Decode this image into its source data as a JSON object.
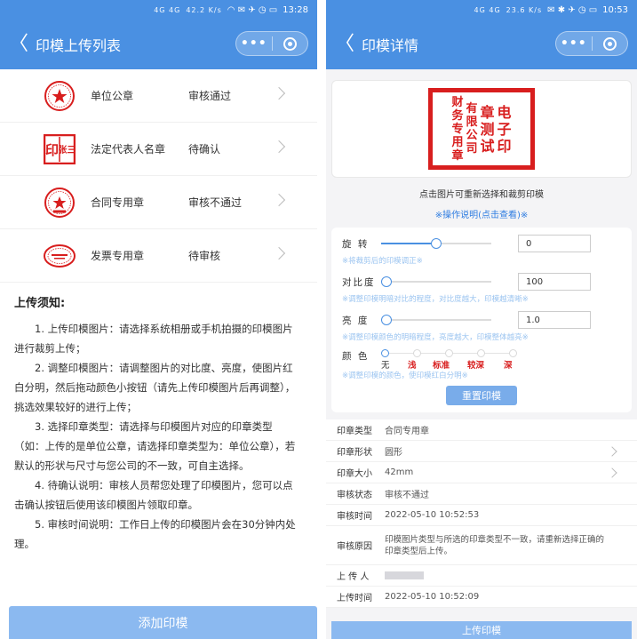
{
  "left": {
    "status": {
      "network": "4G 4G",
      "speed": "42.2 K/s",
      "time": "13:28"
    },
    "nav": {
      "back": "〈",
      "title": "印模上传列表",
      "more": "•••"
    },
    "seals": [
      {
        "name": "单位公章",
        "status": "审核通过",
        "icon": "round-official-seal-icon"
      },
      {
        "name": "法定代表人名章",
        "status": "待确认",
        "icon": "square-personal-seal-icon",
        "seal_text": [
          "印",
          "张三"
        ]
      },
      {
        "name": "合同专用章",
        "status": "审核不通过",
        "icon": "round-contract-seal-icon"
      },
      {
        "name": "发票专用章",
        "status": "待审核",
        "icon": "oval-invoice-seal-icon"
      }
    ],
    "notice": {
      "title": "上传须知:",
      "items": [
        "1. 上传印模图片：请选择系统相册或手机拍摄的印模图片进行裁剪上传；",
        "2. 调整印模图片：请调整图片的对比度、亮度，使图片红白分明，然后拖动颜色小按钮（请先上传印模图片后再调整），挑选效果较好的进行上传；",
        "3. 选择印章类型：请选择与印模图片对应的印章类型（如：上传的是单位公章，请选择印章类型为：单位公章），若默认的形状与尺寸与您公司的不一致，可自主选择。",
        "4. 待确认说明：审核人员帮您处理了印模图片，您可以点击确认按钮后使用该印模图片领取印章。",
        "5. 审核时间说明：工作日上传的印模图片会在30分钟内处理。"
      ]
    },
    "add_button": "添加印模"
  },
  "right": {
    "status": {
      "network": "4G 4G",
      "speed": "23.6 K/s",
      "time": "10:53"
    },
    "nav": {
      "back": "〈",
      "title": "印模详情",
      "more": "•••"
    },
    "stamp_columns": [
      "电子印",
      "章测试",
      "有限公司",
      "财务专用章"
    ],
    "hint": "点击图片可重新选择和裁剪印模",
    "guide_link": "※操作说明(点击查看)※",
    "controls": {
      "rotate": {
        "label": "旋 转",
        "value": "0",
        "desc": "※将裁剪后的印模调正※",
        "level": 0.5
      },
      "contrast": {
        "label": "对比度",
        "value": "100",
        "desc": "※调整印模明暗对比的程度，对比度越大，印模越清晰※",
        "level": 0.0
      },
      "brightness": {
        "label": "亮 度",
        "value": "1.0",
        "desc": "※调整印模颜色的明暗程度，亮度越大，印模整体越亮※",
        "level": 0.0
      }
    },
    "color": {
      "label": "颜 色",
      "options": [
        "无",
        "浅",
        "标准",
        "较深",
        "深"
      ],
      "selected": "无",
      "desc": "※调整印模的颜色，使印模红白分明※"
    },
    "reset_button": "重置印模",
    "info": [
      {
        "key": "印章类型",
        "value": "合同专用章"
      },
      {
        "key": "印章形状",
        "value": "圆形"
      },
      {
        "key": "印章大小",
        "value": "42mm"
      },
      {
        "key": "审核状态",
        "value": "审核不通过"
      },
      {
        "key": "审核时间",
        "value": "2022-05-10 10:52:53"
      },
      {
        "key": "审核原因",
        "value": "印模图片类型与所选的印章类型不一致，请重新选择正确的印章类型后上传。"
      },
      {
        "key": "上 传 人",
        "value": ""
      },
      {
        "key": "上传时间",
        "value": "2022-05-10 10:52:09"
      }
    ],
    "upload_button": "上传印模"
  },
  "colors": {
    "primary": "#4a90e2",
    "button": "#8bb9f0",
    "seal_red": "#d81e1e",
    "desc_blue": "#9bc4f0"
  }
}
